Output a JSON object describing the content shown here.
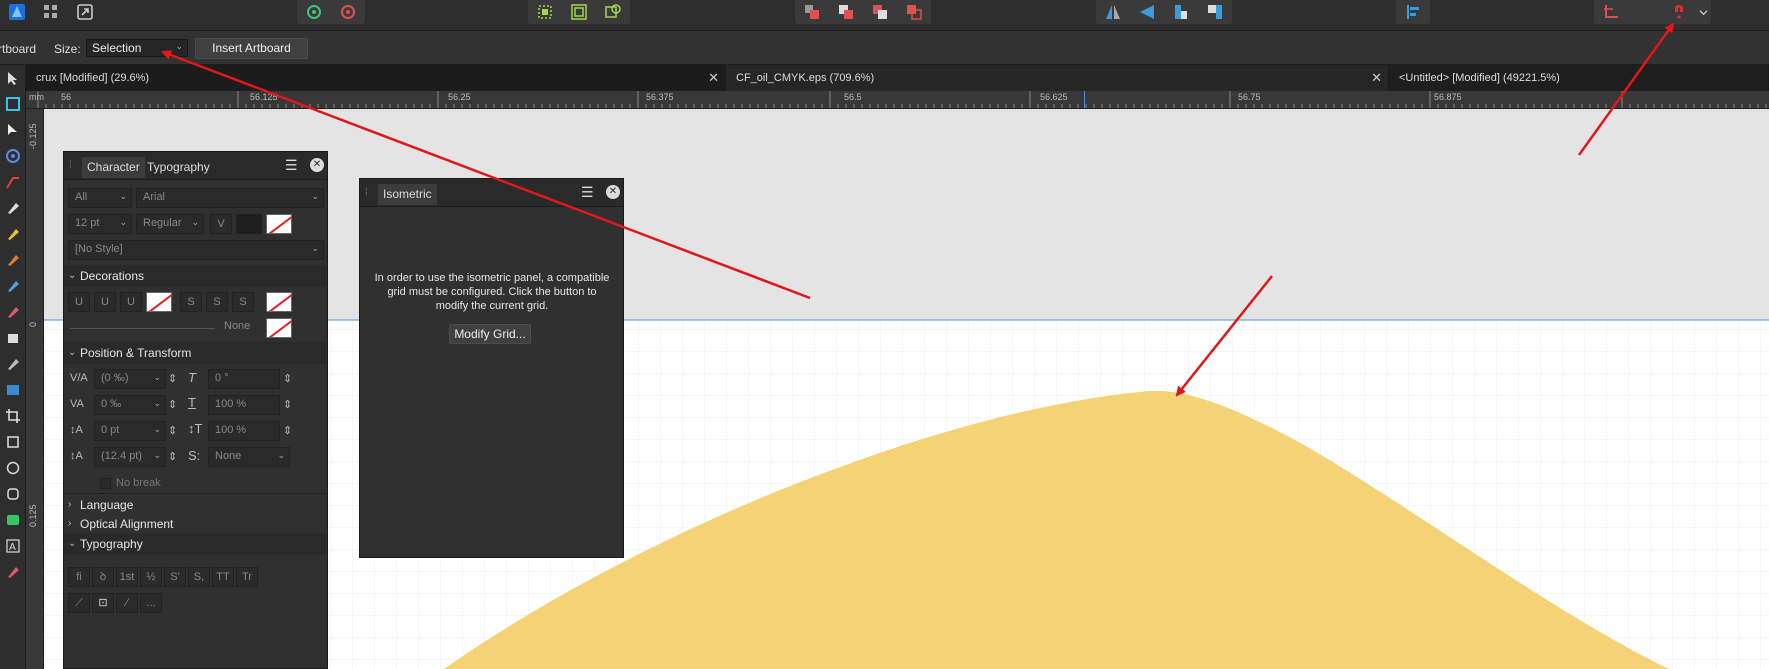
{
  "toolbar": {
    "groups": [
      {
        "icons": [
          "affinity-logo-icon",
          "persona-grid-icon",
          "export-persona-icon"
        ]
      },
      {
        "icons": [
          "settings-gear-icon",
          "settings-snap-icon"
        ]
      },
      {
        "icons": [
          "transform-selection-icon",
          "transform-fit-icon",
          "transform-origin-icon"
        ]
      },
      {
        "icons": [
          "arrange-back-icon",
          "arrange-backward-icon",
          "arrange-forward-icon",
          "arrange-front-icon"
        ]
      },
      {
        "icons": [
          "flip-horizontal-icon",
          "flip-vertical-icon",
          "rotate-left-icon",
          "rotate-right-icon"
        ]
      },
      {
        "icons": [
          "align-left-icon"
        ]
      },
      {
        "icons": [
          "snapping-icon",
          "blank-icon",
          "magnet-snap-icon",
          "chevron-down-icon"
        ]
      }
    ]
  },
  "context": {
    "artboard_label": "rtboard",
    "size_label": "Size:",
    "size_value": "Selection",
    "insert_button": "Insert Artboard"
  },
  "tabs": [
    {
      "label": "crux [Modified] (29.6%)"
    },
    {
      "label": "CF_oil_CMYK.eps (709.6%)"
    },
    {
      "label": "<Untitled> [Modified] (49221.5%)"
    }
  ],
  "ruler": {
    "unit": "mm",
    "top_labels": [
      "56",
      "56.125",
      "56.25",
      "56.375",
      "56.5",
      "56.625",
      "56.75",
      "56.875"
    ],
    "left_labels": [
      "-0.125",
      "0",
      "0.125"
    ]
  },
  "character_panel": {
    "tab_character": "Character",
    "tab_typography": "Typography",
    "scope": "All",
    "font": "Arial",
    "size": "12 pt",
    "weight": "Regular",
    "style": "[No Style]",
    "decorations_title": "Decorations",
    "line_none": "None",
    "position_title": "Position & Transform",
    "kerning": "(0 ‰)",
    "tracking": "0 ‰",
    "baseline": "0 pt",
    "leading": "(12.4 pt)",
    "shear": "0 °",
    "horizontal_scale": "100 %",
    "vertical_scale": "100 %",
    "position_mode": "None",
    "no_break": "No break",
    "language_title": "Language",
    "optical_title": "Optical Alignment",
    "typography_title": "Typography",
    "typo_buttons": [
      "fi",
      "ꝺ",
      "1st",
      "½",
      "S'",
      "S,",
      "TT",
      "Tr"
    ],
    "typo_buttons_row2": [
      "⟋",
      "⊡",
      "∕",
      "..."
    ]
  },
  "isometric_panel": {
    "tab": "Isometric",
    "message": "In order to use the isometric panel, a compatible grid must be configured. Click the button to modify the current grid.",
    "button": "Modify Grid..."
  },
  "colors": {
    "shape_fill": "#f5d275",
    "arrow": "#e01818",
    "guide": "#4a90e2",
    "canvas_bg": "#e4e4e4",
    "grid_bg": "#ffffff"
  }
}
